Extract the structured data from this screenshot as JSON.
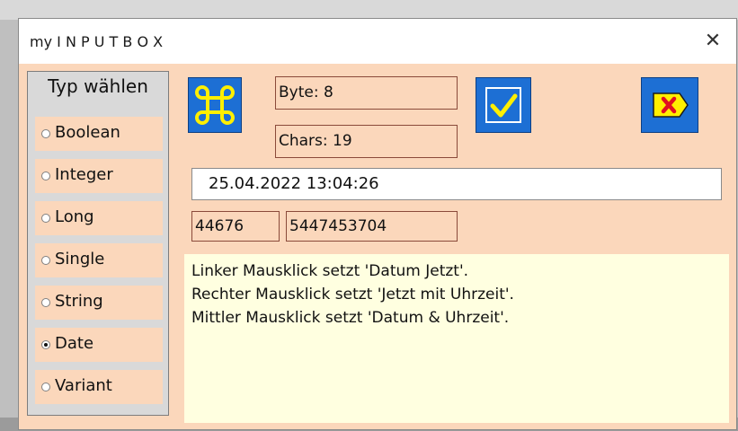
{
  "window": {
    "title": "my I N P U T B O X",
    "close_label": "✕"
  },
  "type_panel": {
    "heading": "Typ wählen",
    "options": [
      {
        "label": "Boolean",
        "selected": false
      },
      {
        "label": "Integer",
        "selected": false
      },
      {
        "label": "Long",
        "selected": false
      },
      {
        "label": "Single",
        "selected": false
      },
      {
        "label": "String",
        "selected": false
      },
      {
        "label": "Date",
        "selected": true
      },
      {
        "label": "Variant",
        "selected": false
      }
    ]
  },
  "info": {
    "byte_text": "Byte: 8",
    "chars_text": "Chars: 19"
  },
  "input": {
    "value": "25.04.2022 13:04:26"
  },
  "numbers": {
    "serial": "44676",
    "raw": "5447453704"
  },
  "help_lines": [
    "Linker Mausklick setzt 'Datum Jetzt'.",
    "Rechter Mausklick setzt 'Jetzt mit Uhrzeit'.",
    "Mittler Mausklick setzt 'Datum & Uhrzeit'."
  ],
  "buttons": {
    "command_icon": "command-icon",
    "ok_icon": "checkmark-icon",
    "cancel_icon": "cancel-tag-icon"
  },
  "colors": {
    "form_bg": "#fbd7bb",
    "button_blue": "#1d6fd4",
    "icon_yellow": "#ffef00",
    "cancel_red": "#e01020",
    "help_bg": "#ffffe0"
  }
}
